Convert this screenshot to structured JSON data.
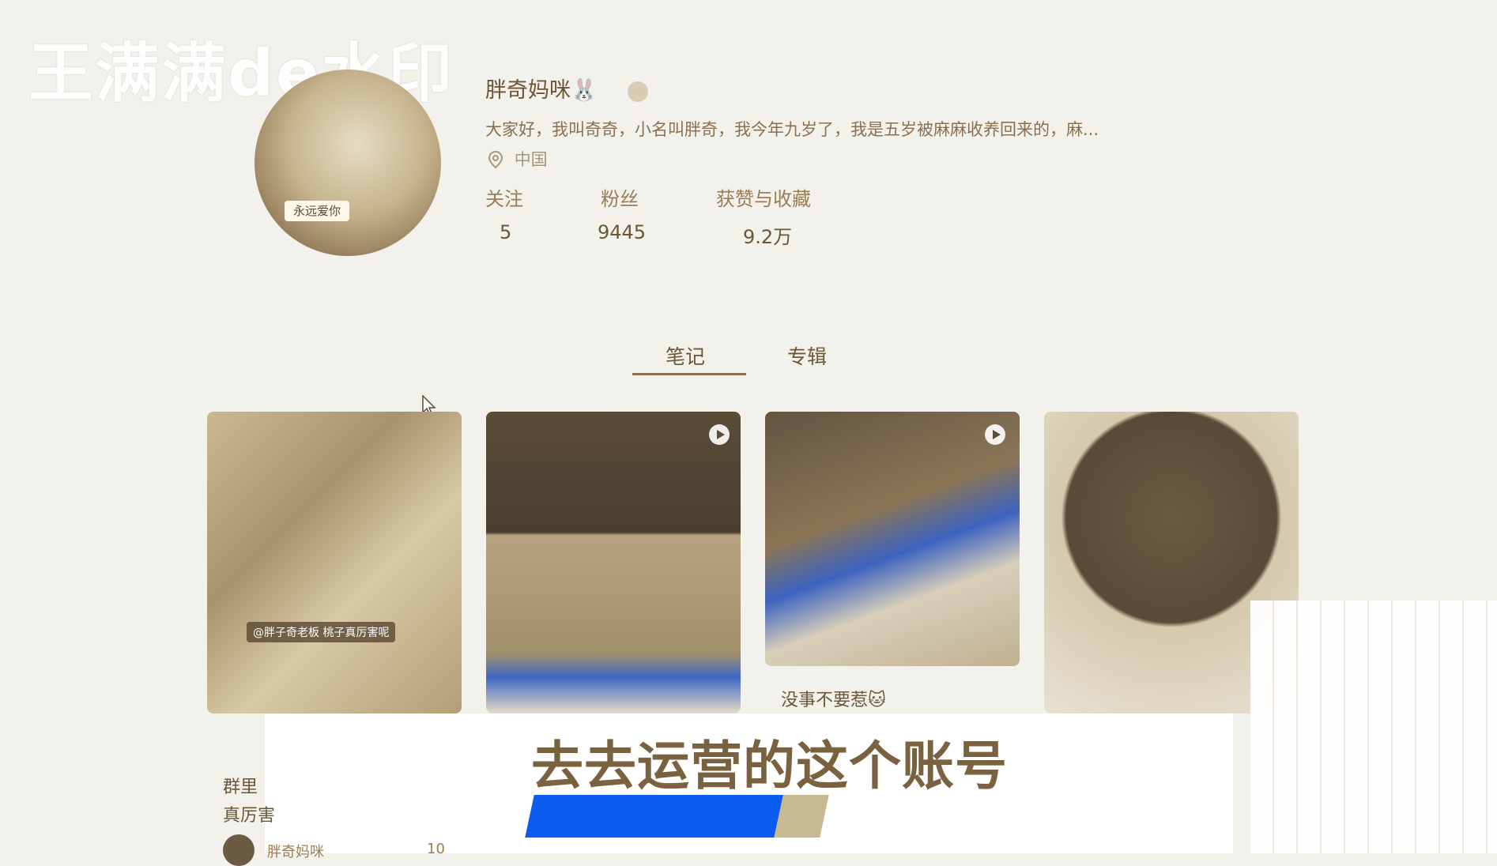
{
  "watermark": "王满满de水印",
  "profile": {
    "name": "胖奇妈咪🐰",
    "bio": "大家好，我叫奇奇，小名叫胖奇，我今年九岁了，我是五岁被麻麻收养回来的，麻...",
    "location": "中国",
    "avatar_sticker": "永远爱你",
    "stats": [
      {
        "label": "关注",
        "value": "5"
      },
      {
        "label": "粉丝",
        "value": "9445"
      },
      {
        "label": "获赞与收藏",
        "value": "9.2万"
      }
    ]
  },
  "tabs": [
    {
      "label": "笔记",
      "active": true
    },
    {
      "label": "专辑",
      "active": false
    }
  ],
  "cards": [
    {
      "title_line1": "群里",
      "title_line2": "真厉害",
      "overlay_text": "@胖子奇老板 桃子真厉害呢",
      "author": "胖奇妈咪",
      "likes": "10"
    },
    {
      "title": ""
    },
    {
      "title": "没事不要惹🐱"
    },
    {
      "title": ""
    }
  ],
  "subtitle": "去去运营的这个账号",
  "colors": {
    "accent_blue": "#0b5cf0",
    "text": "#6b5636"
  }
}
